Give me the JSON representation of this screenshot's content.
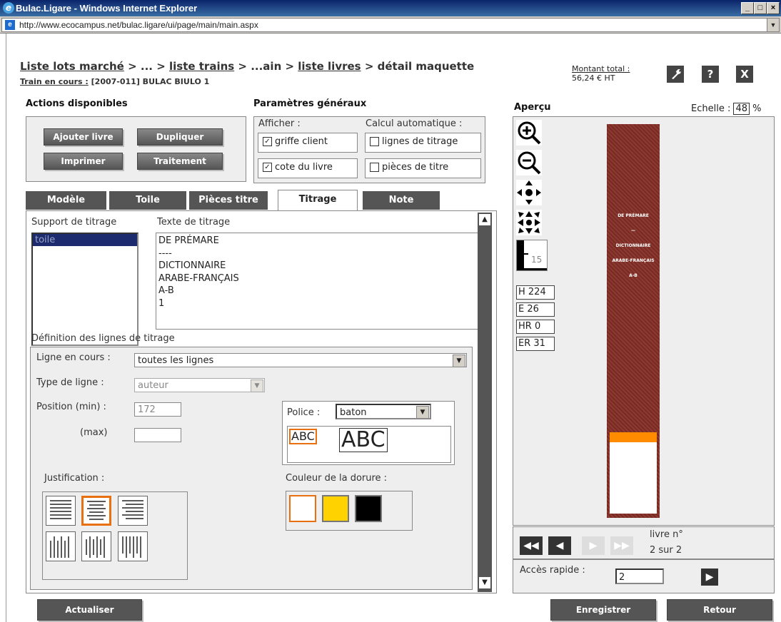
{
  "window": {
    "title": "Bulac.Ligare - Windows Internet Explorer",
    "url": "http://www.ecocampus.net/bulac.ligare/ui/page/main/main.aspx"
  },
  "header": {
    "crumbs": [
      "Liste lots marché",
      " > ... > ",
      "liste trains",
      " > ...ain > ",
      "liste livres",
      " > détail maquette"
    ],
    "train_label": "Train en cours :",
    "train_value": "[2007-011] BULAC BIULO 1",
    "montant_label": "Montant total :",
    "montant_value": "56,24 € HT",
    "icons": {
      "tools": "?",
      "help": "?",
      "close": "X"
    }
  },
  "actions": {
    "title": "Actions disponibles",
    "buttons": [
      "Ajouter livre",
      "Dupliquer",
      "Imprimer",
      "Traitement"
    ]
  },
  "params": {
    "title": "Paramètres généraux",
    "afficher": "Afficher :",
    "calcul": "Calcul automatique :",
    "griffe": "griffe client",
    "cote": "cote du livre",
    "lignes": "lignes de titrage",
    "pieces": "pièces de titre",
    "check": "☑"
  },
  "tabs": [
    "Modèle",
    "Toile",
    "Pièces titre",
    "Titrage",
    "Note"
  ],
  "titrage": {
    "support_label": "Support de titrage",
    "support_item": "toile",
    "texte_label": "Texte de titrage",
    "texte_lines": [
      "DE PRÉMARE",
      "----",
      "DICTIONNAIRE",
      "ARABE-FRANÇAIS",
      "A-B",
      "1"
    ],
    "definition_label": "Définition des lignes de titrage",
    "ligne_label": "Ligne en cours :",
    "ligne_value": "toutes les lignes",
    "type_label": "Type de ligne :",
    "type_value": "auteur",
    "pos_min_label": "Position (min) :",
    "pos_min_value": "172",
    "pos_max_label": "(max)",
    "police_label": "Police :",
    "police_value": "baton",
    "abc": "ABC",
    "justification_label": "Justification :",
    "couleur_label": "Couleur de la dorure :",
    "colors": [
      "#ffffff",
      "#ffd200",
      "#000000"
    ]
  },
  "apercu": {
    "title": "Aperçu",
    "echelle_label": "Echelle :",
    "echelle_value": "48",
    "pct": "%",
    "ruler_value": "15",
    "dims": [
      "H 224",
      "E 26",
      "HR 0",
      "ER 31"
    ],
    "spine_lines": [
      "DE PRÉMARE",
      "—",
      "DICTIONNAIRE",
      "ARABE-FRANÇAIS",
      "A-B"
    ],
    "livre_label": "livre n°",
    "livre_value": "2 sur 2",
    "acces_label": "Accès rapide :",
    "acces_value": "2"
  },
  "footer": {
    "actualiser": "Actualiser",
    "enregistrer": "Enregistrer",
    "retour": "Retour"
  }
}
